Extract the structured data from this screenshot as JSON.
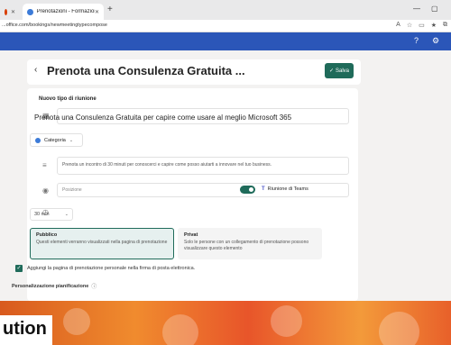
{
  "browser": {
    "tab_active_label": "Prenotazioni - Formazione Abov",
    "url": "...office.com/bookings/newmeetingtypecompose"
  },
  "header": {
    "back_glyph": "‹",
    "title": "Prenota una Consulenza Gratuita ...",
    "save_label": "Salva"
  },
  "form": {
    "section_title": "Nuovo tipo di riunione",
    "meeting_title": "Prenota una Consulenza Gratuita per capire come usare al meglio Microsoft 365",
    "category_label": "Categoria",
    "description": "Prenota un incontro di 30 minuti per conoscerci e capire come posso aiutarti a innovare nel tuo business.",
    "location_placeholder": "Posizione",
    "teams_label": "Riunione di Teams",
    "duration": "30 min",
    "public": {
      "label": "Pubblico",
      "desc": "Questi elementi verranno visualizzati nella pagina di prenotazione"
    },
    "private": {
      "label": "Privat",
      "desc": "Solo le persone con un collegamento di prenotazione possono visualizzare questo elemento"
    },
    "checkbox_label": "Aggiungi la pagina di prenotazione personale nella firma di posta elettronica.",
    "personalization_label": "Personalizzazione pianificazione"
  },
  "footer": {
    "brand_text": "ution"
  },
  "colors": {
    "appbar": "#2b56b8",
    "accent": "#1f6b5a",
    "footer": "#e8602a"
  }
}
